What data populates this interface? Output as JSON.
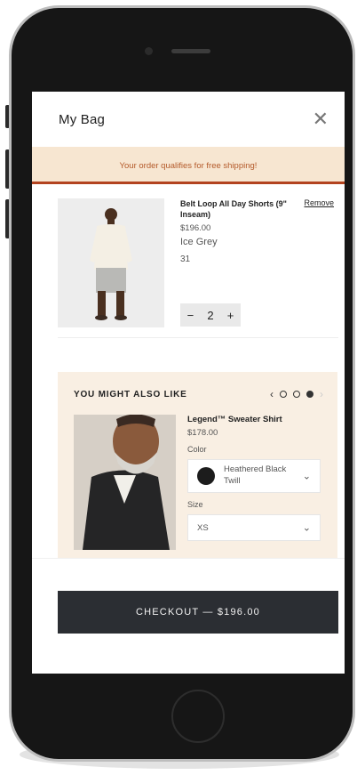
{
  "header": {
    "title": "My Bag",
    "close_icon": "close-icon"
  },
  "banner": {
    "text": "Your order qualifies for free shipping!",
    "accent": "#b3431f",
    "background": "#f7e6d1"
  },
  "cart_item": {
    "name": "Belt Loop All Day Shorts (9\" Inseam)",
    "price": "$196.00",
    "color": "Ice Grey",
    "size": "31",
    "remove_label": "Remove",
    "quantity": "2",
    "minus_label": "−",
    "plus_label": "+"
  },
  "recommendations": {
    "title": "YOU MIGHT ALSO LIKE",
    "prev_icon": "chevron-left-icon",
    "next_icon": "chevron-right-icon",
    "page_count": 3,
    "active_page": 3,
    "product": {
      "name": "Legend™ Sweater Shirt",
      "price": "$178.00",
      "color_label": "Color",
      "color_value": "Heathered Black Twill",
      "size_label": "Size",
      "size_value": "XS"
    }
  },
  "checkout": {
    "label": "CHECKOUT — $196.00",
    "color": "#2b2e33"
  }
}
